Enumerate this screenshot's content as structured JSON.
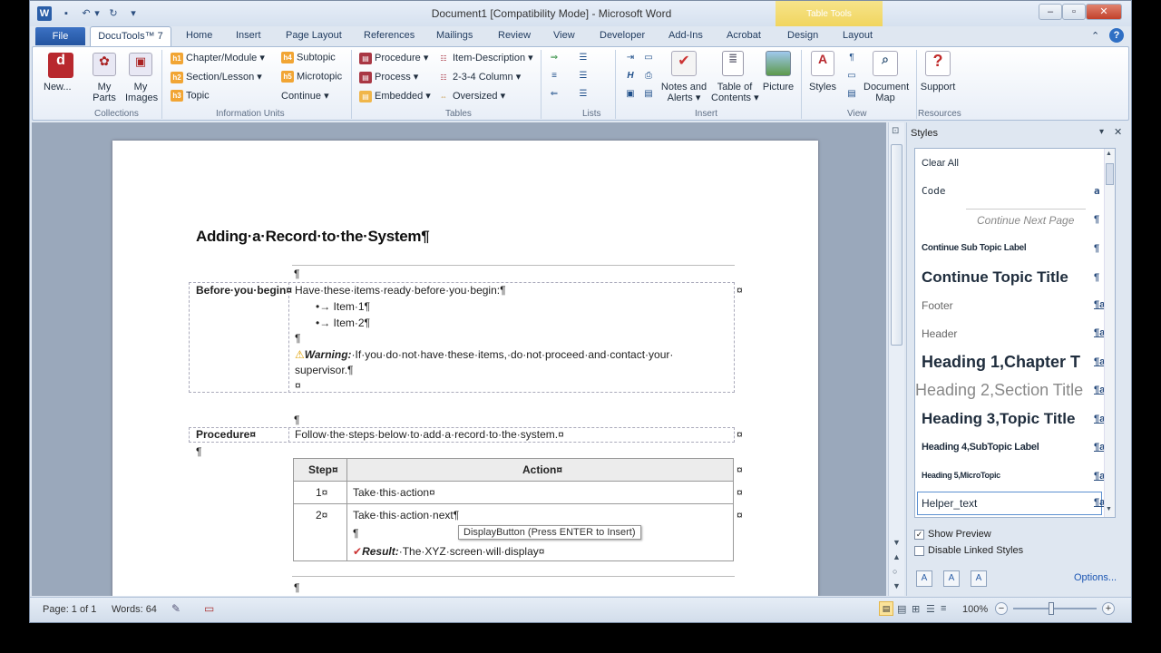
{
  "window": {
    "title": "Document1 [Compatibility Mode] - Microsoft Word",
    "context_tab": "Table Tools"
  },
  "tabs": [
    "File",
    "DocuTools™ 7",
    "Home",
    "Insert",
    "Page Layout",
    "References",
    "Mailings",
    "Review",
    "View",
    "Developer",
    "Add-Ins",
    "Acrobat",
    "Design",
    "Layout"
  ],
  "ribbon": {
    "collections": {
      "new": "New...",
      "my_parts": [
        "My",
        "Parts"
      ],
      "my_images": [
        "My",
        "Images"
      ],
      "label": "Collections"
    },
    "info_units": {
      "h1": "Chapter/Module",
      "h2": "Section/Lesson",
      "h3": "Topic",
      "h4": "Subtopic",
      "h5": "Microtopic",
      "continue": "Continue",
      "label": "Information Units",
      "badges": {
        "h1": "h1",
        "h2": "h2",
        "h3": "h3",
        "h4": "h4",
        "h5": "h5"
      }
    },
    "tables": {
      "procedure": "Procedure",
      "process": "Process",
      "embedded": "Embedded",
      "item_desc": "Item-Description",
      "col234": "2-3-4 Column",
      "oversized": "Oversized",
      "label": "Tables"
    },
    "lists_label": "Lists",
    "insert": {
      "notes": [
        "Notes and",
        "Alerts"
      ],
      "toc": [
        "Table of",
        "Contents"
      ],
      "picture": "Picture",
      "label": "Insert"
    },
    "view": {
      "styles": "Styles",
      "docmap": [
        "Document",
        "Map"
      ],
      "label": "View"
    },
    "resources": {
      "support": "Support",
      "label": "Resources"
    }
  },
  "document": {
    "title": "Adding·a·Record·to·the·System¶",
    "before_label": "Before·you·begin¤",
    "before_intro": "Have·these·items·ready·before·you·begin:¶",
    "bullet1": "•→ Item·1¶",
    "bullet2": "•→ Item·2¶",
    "pilcrow": "¶",
    "cellmark": "¤",
    "warning_label": "Warning:",
    "warning_text": "·If·you·do·not·have·these·items,·do·not·proceed·and·contact·your·",
    "warning_text2": "supervisor.¶",
    "procedure_label": "Procedure¤",
    "procedure_text": "Follow·the·steps·below·to·add·a·record·to·the·system.¤",
    "step_header": "Step¤",
    "action_header": "Action¤",
    "step1_num": "1¤",
    "step1_action": "Take·this·action¤",
    "step2_num": "2¤",
    "step2_action": "Take·this·action·next¶",
    "result_label": "Result:",
    "result_text": "·The·XYZ·screen·will·display¤"
  },
  "tooltip": "DisplayButton  (Press ENTER to Insert)",
  "styles_pane": {
    "title": "Styles",
    "items": [
      {
        "name": "Clear All",
        "mark": ""
      },
      {
        "name": "Code",
        "mark": "a"
      },
      {
        "name": "Continue Next Page",
        "mark": "¶"
      },
      {
        "name": "Continue Sub Topic Label",
        "mark": "¶"
      },
      {
        "name": "Continue Topic Title",
        "mark": "¶"
      },
      {
        "name": "Footer",
        "mark": "¶a"
      },
      {
        "name": "Header",
        "mark": "¶a"
      },
      {
        "name": "Heading 1,Chapter T",
        "mark": "¶a"
      },
      {
        "name": "Heading 2,Section Title",
        "mark": "¶a"
      },
      {
        "name": "Heading 3,Topic Title",
        "mark": "¶a"
      },
      {
        "name": "Heading 4,SubTopic Label",
        "mark": "¶a"
      },
      {
        "name": "Heading 5,MicroTopic",
        "mark": "¶a"
      },
      {
        "name": "Helper_text",
        "mark": "¶a"
      }
    ],
    "show_preview": "Show Preview",
    "disable_linked": "Disable Linked Styles",
    "options": "Options..."
  },
  "status": {
    "page": "Page: 1 of 1",
    "words": "Words: 64",
    "zoom": "100%"
  },
  "colors": {
    "accent": "#2a5ea8",
    "ribbon_bg": "#e8eef7"
  }
}
